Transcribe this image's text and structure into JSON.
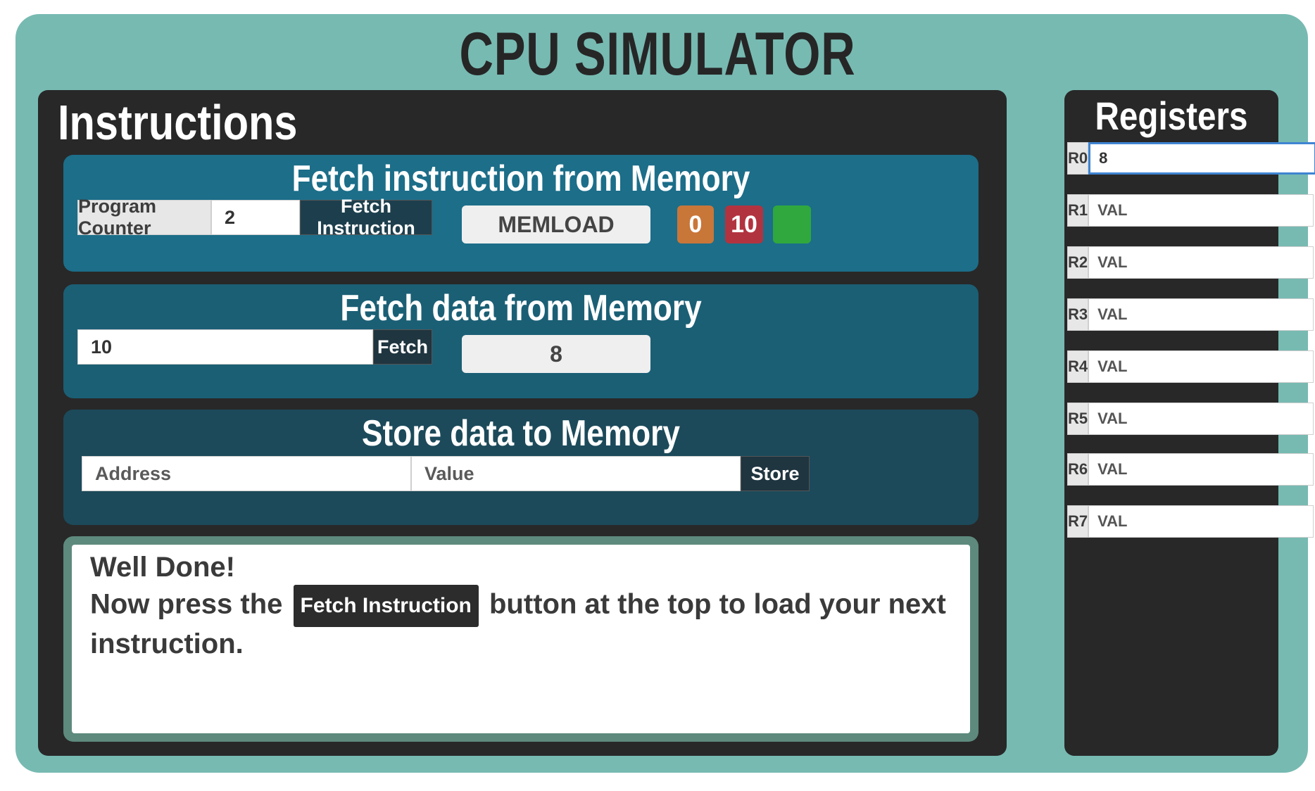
{
  "app": {
    "title": "CPU SIMULATOR"
  },
  "instructions": {
    "heading": "Instructions",
    "fetch_instruction": {
      "title": "Fetch instruction from Memory",
      "pc_label": "Program Counter",
      "pc_value": "2",
      "button": "Fetch Instruction",
      "display": "MEMLOAD",
      "chips": [
        {
          "label": "0",
          "color": "#c97639"
        },
        {
          "label": "10",
          "color": "#b23340"
        },
        {
          "label": "",
          "color": "#30a83d"
        }
      ]
    },
    "fetch_data": {
      "title": "Fetch data from Memory",
      "address_value": "10",
      "button": "Fetch",
      "display": "8"
    },
    "store_data": {
      "title": "Store data to Memory",
      "address_placeholder": "Address",
      "value_placeholder": "Value",
      "button": "Store"
    },
    "message": {
      "line1": "Well Done!",
      "line2_pre": "Now press the",
      "inline_button": "Fetch Instruction",
      "line2_post": "button at the top to load your next",
      "line3": "instruction."
    }
  },
  "registers": {
    "heading": "Registers",
    "items": [
      {
        "label": "R0",
        "value": "8",
        "placeholder": "VAL"
      },
      {
        "label": "R1",
        "value": "",
        "placeholder": "VAL"
      },
      {
        "label": "R2",
        "value": "",
        "placeholder": "VAL"
      },
      {
        "label": "R3",
        "value": "",
        "placeholder": "VAL"
      },
      {
        "label": "R4",
        "value": "",
        "placeholder": "VAL"
      },
      {
        "label": "R5",
        "value": "",
        "placeholder": "VAL"
      },
      {
        "label": "R6",
        "value": "",
        "placeholder": "VAL"
      },
      {
        "label": "R7",
        "value": "",
        "placeholder": "VAL"
      }
    ]
  }
}
